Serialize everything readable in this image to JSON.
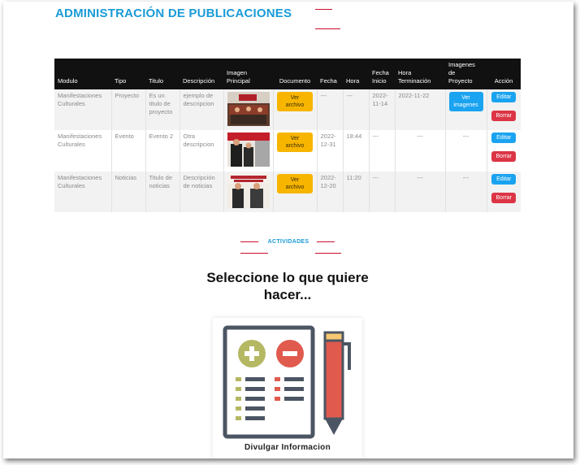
{
  "page": {
    "title": "ADMINISTRACIÓN DE PUBLICACIONES"
  },
  "table": {
    "headers": {
      "modulo": "Modulo",
      "tipo": "Tipo",
      "titulo": "Titulo",
      "descripcion": "Descripción",
      "imagen_l1": "Imagen",
      "imagen_l2": "Principal",
      "documento": "Documento",
      "fecha": "Fecha",
      "hora": "Hora",
      "fecha_inicio_l1": "Fecha",
      "fecha_inicio_l2": "Inicio",
      "hora_term_l1": "Hora",
      "hora_term_l2": "Terminación",
      "imagenes_l1": "Imagenes",
      "imagenes_l2": "de",
      "imagenes_l3": "Proyecto",
      "accion": "Acción"
    },
    "rows": [
      {
        "modulo_l1": "Manifestaciones",
        "modulo_l2": "Culturales",
        "tipo": "Proyecto",
        "titulo_l1": "Es un",
        "titulo_l2": "titulo de",
        "titulo_l3": "proyecto",
        "desc_l1": "ejemplo de",
        "desc_l2": "descripcion",
        "doc_l1": "Ver",
        "doc_l2": "archivo",
        "fecha_l1": "---",
        "fecha_l2": "",
        "hora": "---",
        "fecha_inicio_l1": "2022-",
        "fecha_inicio_l2": "11-14",
        "hora_term": "2022-11-22",
        "img_btn_l1": "Ver",
        "img_btn_l2": "imagenes",
        "img_text": "",
        "edit": "Editar",
        "delete": "Borrar"
      },
      {
        "modulo_l1": "Manifestaciones",
        "modulo_l2": "Culturales",
        "tipo": "Evento",
        "titulo_l1": "Evento 2",
        "titulo_l2": "",
        "titulo_l3": "",
        "desc_l1": "Otra",
        "desc_l2": "descripcion",
        "doc_l1": "Ver",
        "doc_l2": "archivo",
        "fecha_l1": "2022-",
        "fecha_l2": "12-31",
        "hora": "18:44",
        "fecha_inicio_l1": "---",
        "fecha_inicio_l2": "",
        "hora_term": "---",
        "img_btn_l1": "",
        "img_btn_l2": "",
        "img_text": "---",
        "edit": "Editar",
        "delete": "Borrar"
      },
      {
        "modulo_l1": "Manifestaciones",
        "modulo_l2": "Culturales",
        "tipo": "Noticias",
        "titulo_l1": "Titulo de",
        "titulo_l2": "noticias",
        "titulo_l3": "",
        "desc_l1": "Descripción",
        "desc_l2": "de noticias",
        "doc_l1": "Ver",
        "doc_l2": "archivo",
        "fecha_l1": "2022-",
        "fecha_l2": "12-20",
        "hora": "11:20",
        "fecha_inicio_l1": "---",
        "fecha_inicio_l2": "",
        "hora_term": "---",
        "img_btn_l1": "",
        "img_btn_l2": "",
        "img_text": "---",
        "edit": "Editar",
        "delete": "Borrar"
      }
    ]
  },
  "activities": {
    "section_label": "ACTIVIDADES",
    "headline_l1": "Seleccione lo que quiere",
    "headline_l2": "hacer...",
    "card_label": "Divulgar Informacion",
    "card_icon": "document-edit-icon"
  },
  "colors": {
    "title_blue": "#1a9bd7",
    "accent_red": "#c8102e",
    "header_black": "#111111",
    "warning": "#f7b500",
    "info": "#1aa3f0",
    "danger": "#dc3545"
  }
}
